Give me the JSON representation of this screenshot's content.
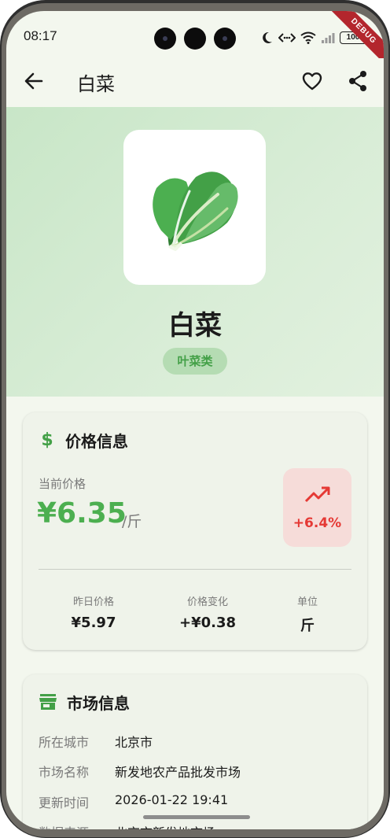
{
  "status_bar": {
    "time": "08:17",
    "battery": "100",
    "debug_banner": "DEBUG"
  },
  "app_bar": {
    "title": "白菜"
  },
  "hero": {
    "product_name": "白菜",
    "category_tag": "叶菜类",
    "image_icon": "lettuce-emoji",
    "background_color": "#c8e6c7"
  },
  "price_card": {
    "title": "价格信息",
    "current_price_label": "当前价格",
    "current_price": "¥6.35",
    "price_unit": "/斤",
    "trend_percent": "+6.4%",
    "trend_color": "#e53935",
    "price_color": "#4caf50",
    "stats": [
      {
        "label": "昨日价格",
        "value": "¥5.97"
      },
      {
        "label": "价格变化",
        "value": "+¥0.38"
      },
      {
        "label": "单位",
        "value": "斤"
      }
    ]
  },
  "market_card": {
    "title": "市场信息",
    "rows": [
      {
        "label": "所在城市",
        "value": "北京市"
      },
      {
        "label": "市场名称",
        "value": "新发地农产品批发市场"
      },
      {
        "label": "更新时间",
        "value": "2026-01-22 19:41"
      },
      {
        "label": "数据来源",
        "value": "北京市新发地市场"
      }
    ]
  }
}
